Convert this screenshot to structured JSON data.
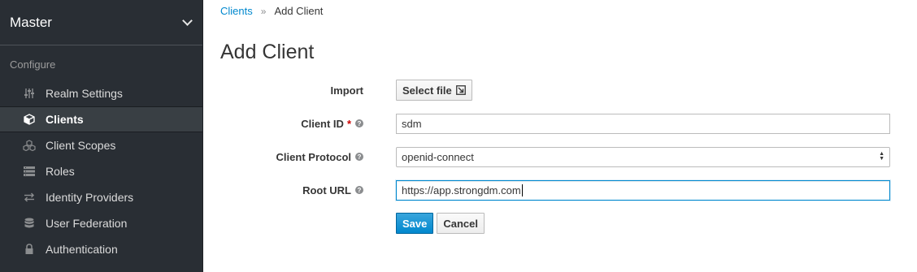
{
  "sidebar": {
    "realm": "Master",
    "section": "Configure",
    "items": [
      {
        "label": "Realm Settings",
        "icon": "sliders-icon"
      },
      {
        "label": "Clients",
        "icon": "cube-icon"
      },
      {
        "label": "Client Scopes",
        "icon": "cubes-icon"
      },
      {
        "label": "Roles",
        "icon": "list-icon"
      },
      {
        "label": "Identity Providers",
        "icon": "exchange-icon"
      },
      {
        "label": "User Federation",
        "icon": "database-icon"
      },
      {
        "label": "Authentication",
        "icon": "lock-icon"
      }
    ],
    "active_index": 1
  },
  "breadcrumb": {
    "link": "Clients",
    "separator": "»",
    "current": "Add Client"
  },
  "page_title": "Add Client",
  "form": {
    "import": {
      "label": "Import",
      "button": "Select file"
    },
    "client_id": {
      "label": "Client ID",
      "required": "*",
      "value": "sdm"
    },
    "client_protocol": {
      "label": "Client Protocol",
      "value": "openid-connect"
    },
    "root_url": {
      "label": "Root URL",
      "value": "https://app.strongdm.com"
    },
    "help_glyph": "?",
    "save": "Save",
    "cancel": "Cancel"
  },
  "colors": {
    "sidebar_bg": "#292e34",
    "link": "#0088ce",
    "primary": "#0088ce",
    "required": "#cc0000"
  }
}
